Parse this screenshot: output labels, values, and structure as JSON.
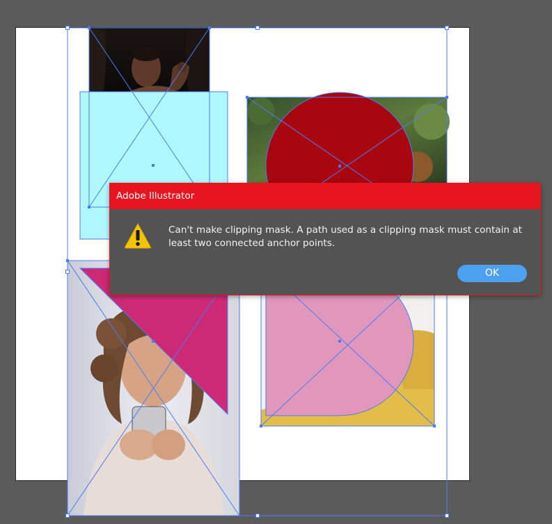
{
  "app": "Adobe Illustrator",
  "colors": {
    "pasteboard": "#5b5b5b",
    "artboard": "#ffffff",
    "selection": "#4b7bf5",
    "cyan_rect": "#aff8ff",
    "red_circle": "#a80710",
    "magenta_triangle": "#cc2a76",
    "pink_shape": "#e197bc",
    "dialog_title_bar": "#e8141f",
    "dialog_body": "#535353",
    "ok_button": "#4d9ff0",
    "warning_yellow": "#f5c400"
  },
  "canvas": {
    "objects": [
      {
        "name": "photo-man",
        "mask": "none"
      },
      {
        "name": "cyan-rectangle",
        "mask": "rectangle"
      },
      {
        "name": "red-circle",
        "mask": "circle"
      },
      {
        "name": "magenta-triangle",
        "mask": "triangle"
      },
      {
        "name": "pink-rounded-shape",
        "mask": "d-shape"
      },
      {
        "name": "photo-woman-phone",
        "mask": "none"
      }
    ]
  },
  "dialog": {
    "title": "Adobe Illustrator",
    "icon": "warning-icon",
    "message": "Can't make clipping mask. A path used as a clipping mask must contain at least two connected anchor points.",
    "ok_label": "OK"
  }
}
